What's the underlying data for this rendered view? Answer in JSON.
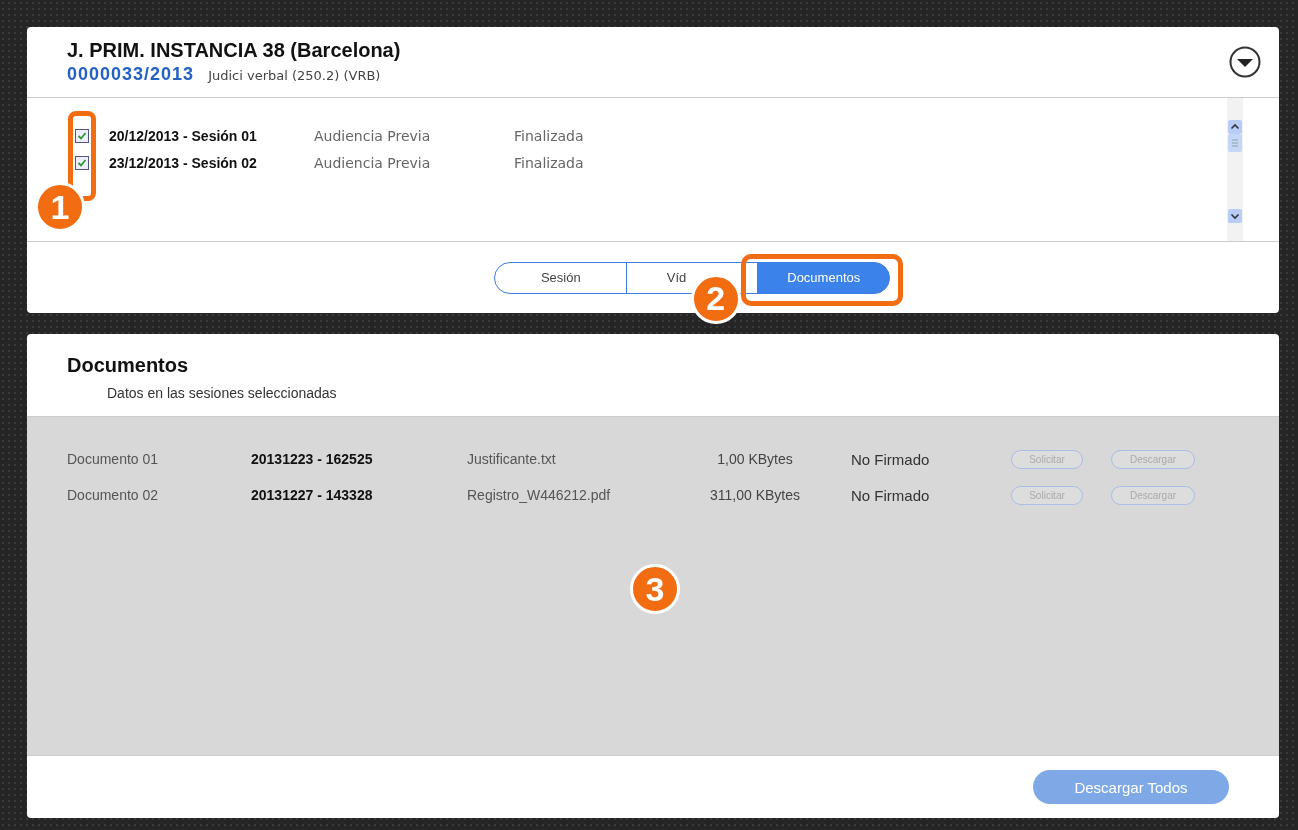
{
  "case": {
    "court": "J. PRIM. INSTANCIA 38 (Barcelona)",
    "number": "0000033/2013",
    "procedure": "Judici verbal (250.2) (VRB)"
  },
  "sessions": [
    {
      "checked": true,
      "label": "20/12/2013 - Sesión 01",
      "type": "Audiencia Previa",
      "status": "Finalizada"
    },
    {
      "checked": true,
      "label": "23/12/2013 - Sesión 02",
      "type": "Audiencia Previa",
      "status": "Finalizada"
    }
  ],
  "tabs": [
    {
      "label": "Sesión",
      "selected": false
    },
    {
      "label": "Víd",
      "selected": false
    },
    {
      "label": "Documentos",
      "selected": true
    }
  ],
  "documents_panel": {
    "title": "Documentos",
    "subtitle": "Datos en las sesiones seleccionadas"
  },
  "documents": [
    {
      "name": "Documento 01",
      "timestamp": "20131223 - 162525",
      "file": "Justificante.txt",
      "size": "1,00 KBytes",
      "signature": "No Firmado",
      "request": {
        "label": "Solicitar",
        "disabled": true
      },
      "download": {
        "label": "Descargar",
        "disabled": true
      }
    },
    {
      "name": "Documento 02",
      "timestamp": "20131227 - 143328",
      "file": "Registro_W446212.pdf",
      "size": "311,00 KBytes",
      "signature": "No Firmado",
      "request": {
        "label": "Solicitar",
        "disabled": true
      },
      "download": {
        "label": "Descargar",
        "disabled": true
      }
    }
  ],
  "download_all": {
    "label": "Descargar Todos",
    "disabled": true
  },
  "callouts": [
    {
      "number": "1"
    },
    {
      "number": "2"
    },
    {
      "number": "3"
    }
  ]
}
